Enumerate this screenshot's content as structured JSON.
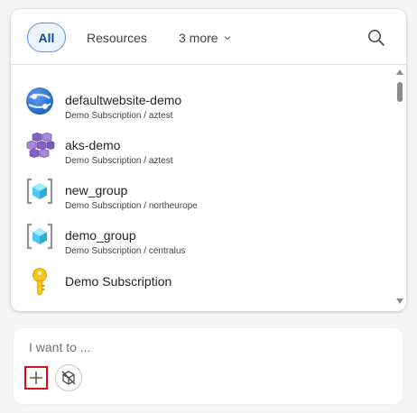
{
  "tabs": {
    "all_label": "All",
    "resources_label": "Resources",
    "more_label": "3 more"
  },
  "items": [
    {
      "name": "defaultwebsite-demo",
      "sub": "Demo Subscription / aztest",
      "icon": "app-service-icon"
    },
    {
      "name": "aks-demo",
      "sub": "Demo Subscription / aztest",
      "icon": "kubernetes-service-icon"
    },
    {
      "name": "new_group",
      "sub": "Demo Subscription / northeurope",
      "icon": "resource-group-icon"
    },
    {
      "name": "demo_group",
      "sub": "Demo Subscription / centralus",
      "icon": "resource-group-icon"
    },
    {
      "name": "Demo Subscription",
      "sub": "",
      "icon": "subscription-key-icon"
    },
    {
      "name": "",
      "sub": "",
      "icon": "partial-resource-icon"
    }
  ],
  "composer": {
    "placeholder": "I want to ..."
  },
  "colors": {
    "accent": "#0f6cbd",
    "tab_selected_bg": "#ebf3fc",
    "highlight_border": "#d4111a"
  }
}
